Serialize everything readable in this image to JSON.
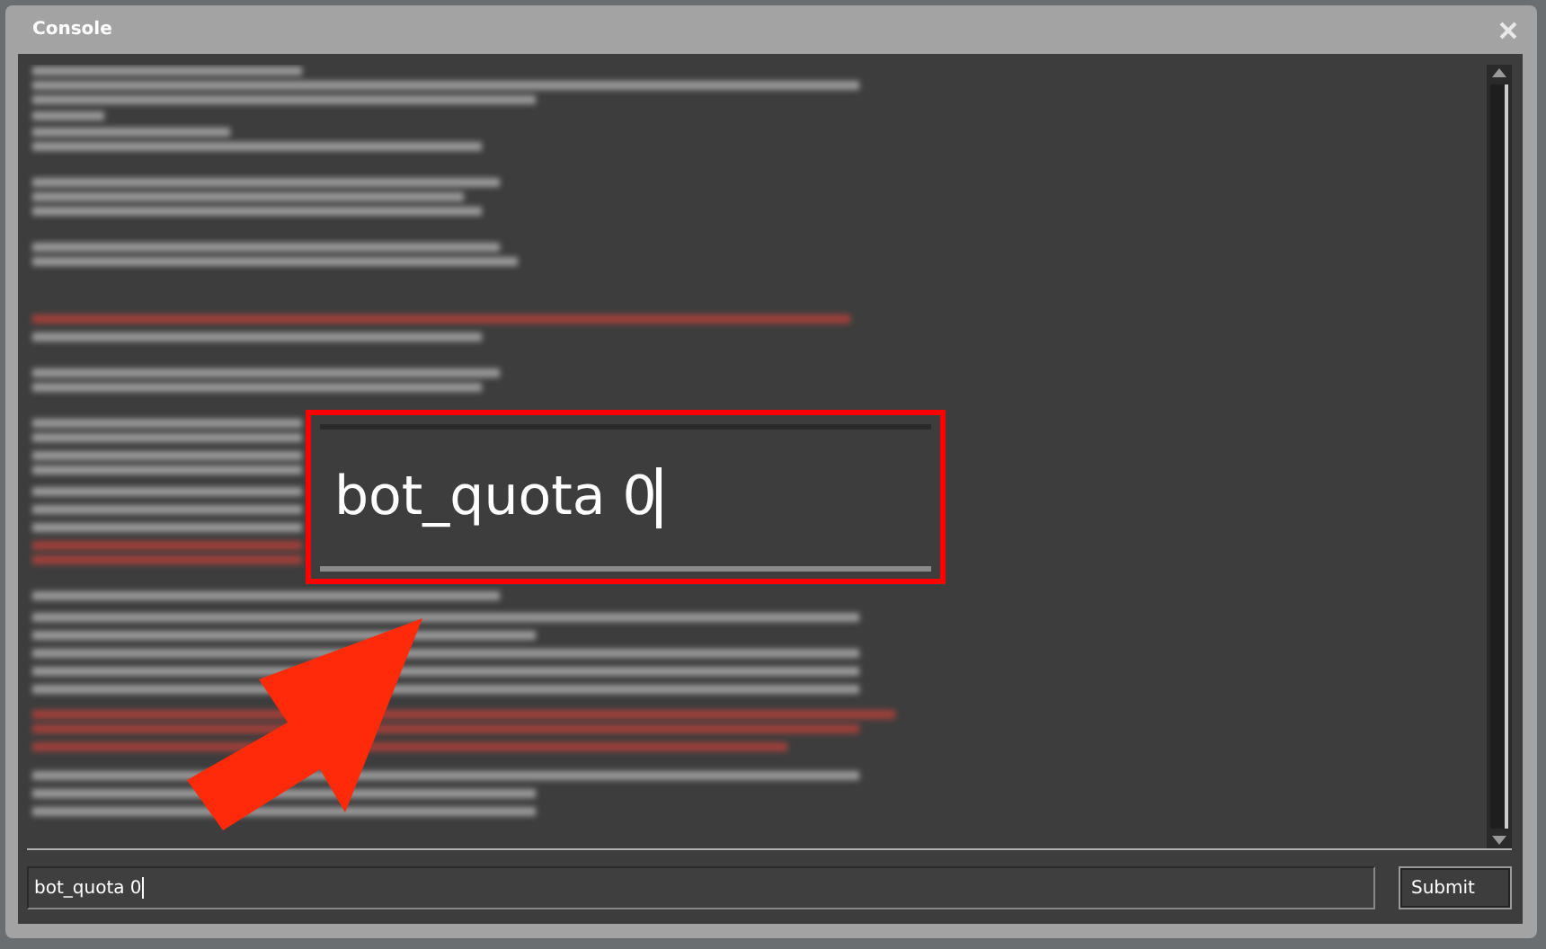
{
  "window": {
    "title": "Console"
  },
  "console_input": {
    "value": "bot_quota 0"
  },
  "submit_button": {
    "label": "Submit"
  },
  "zoom_callout": {
    "value": "bot_quota 0"
  }
}
